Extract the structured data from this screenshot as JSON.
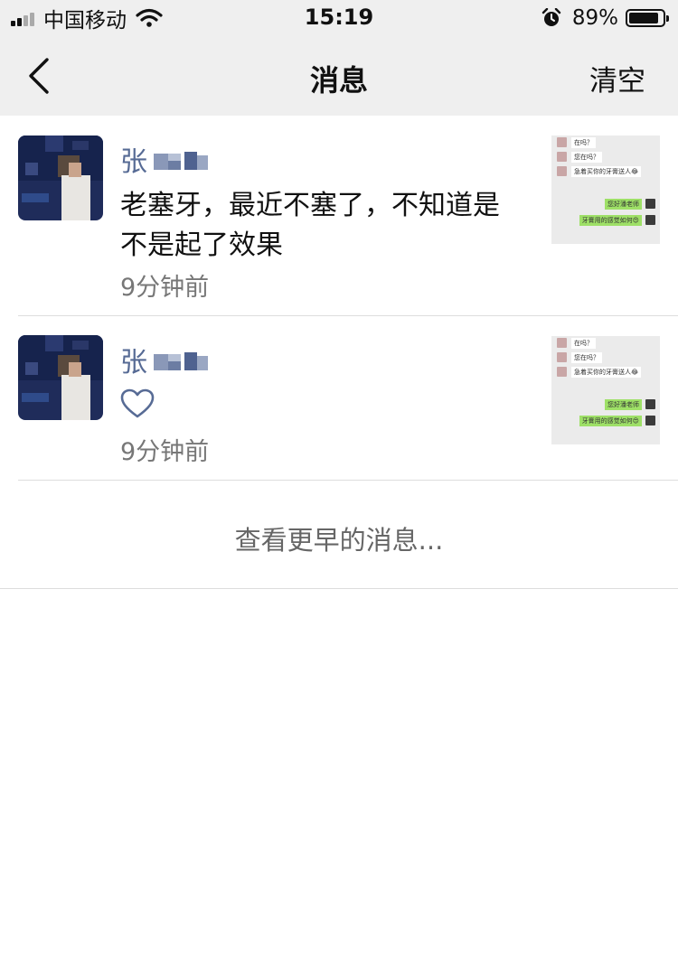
{
  "status_bar": {
    "carrier": "中国移动",
    "time": "15:19",
    "battery": "89%",
    "battery_level": 0.89,
    "icons": [
      "signal-icon",
      "wifi-icon",
      "alarm-icon",
      "battery-icon"
    ]
  },
  "nav": {
    "back_icon": "chevron-left-icon",
    "title": "消息",
    "clear_label": "清空"
  },
  "messages": [
    {
      "sender": "张",
      "text": "老塞牙，最近不塞了，不知道是不是起了效果",
      "time": "9分钟前",
      "thumb": {
        "rows": [
          "在吗？",
          "您在吗？",
          "急着买你的牙膏送人😂",
          "您好潘老师",
          "牙膏用的感觉如何😍"
        ]
      }
    },
    {
      "sender": "张",
      "like_icon": "heart-outline-icon",
      "time": "9分钟前",
      "thumb": {
        "rows": [
          "在吗？",
          "您在吗？",
          "急着买你的牙膏送人😂",
          "您好潘老师",
          "牙膏用的感觉如何😍"
        ]
      }
    }
  ],
  "more_label": "查看更早的消息...",
  "colors": {
    "bar_bg": "#efefef",
    "sender_name": "#576b95",
    "timestamp": "#777777",
    "divider": "#dddddd"
  }
}
